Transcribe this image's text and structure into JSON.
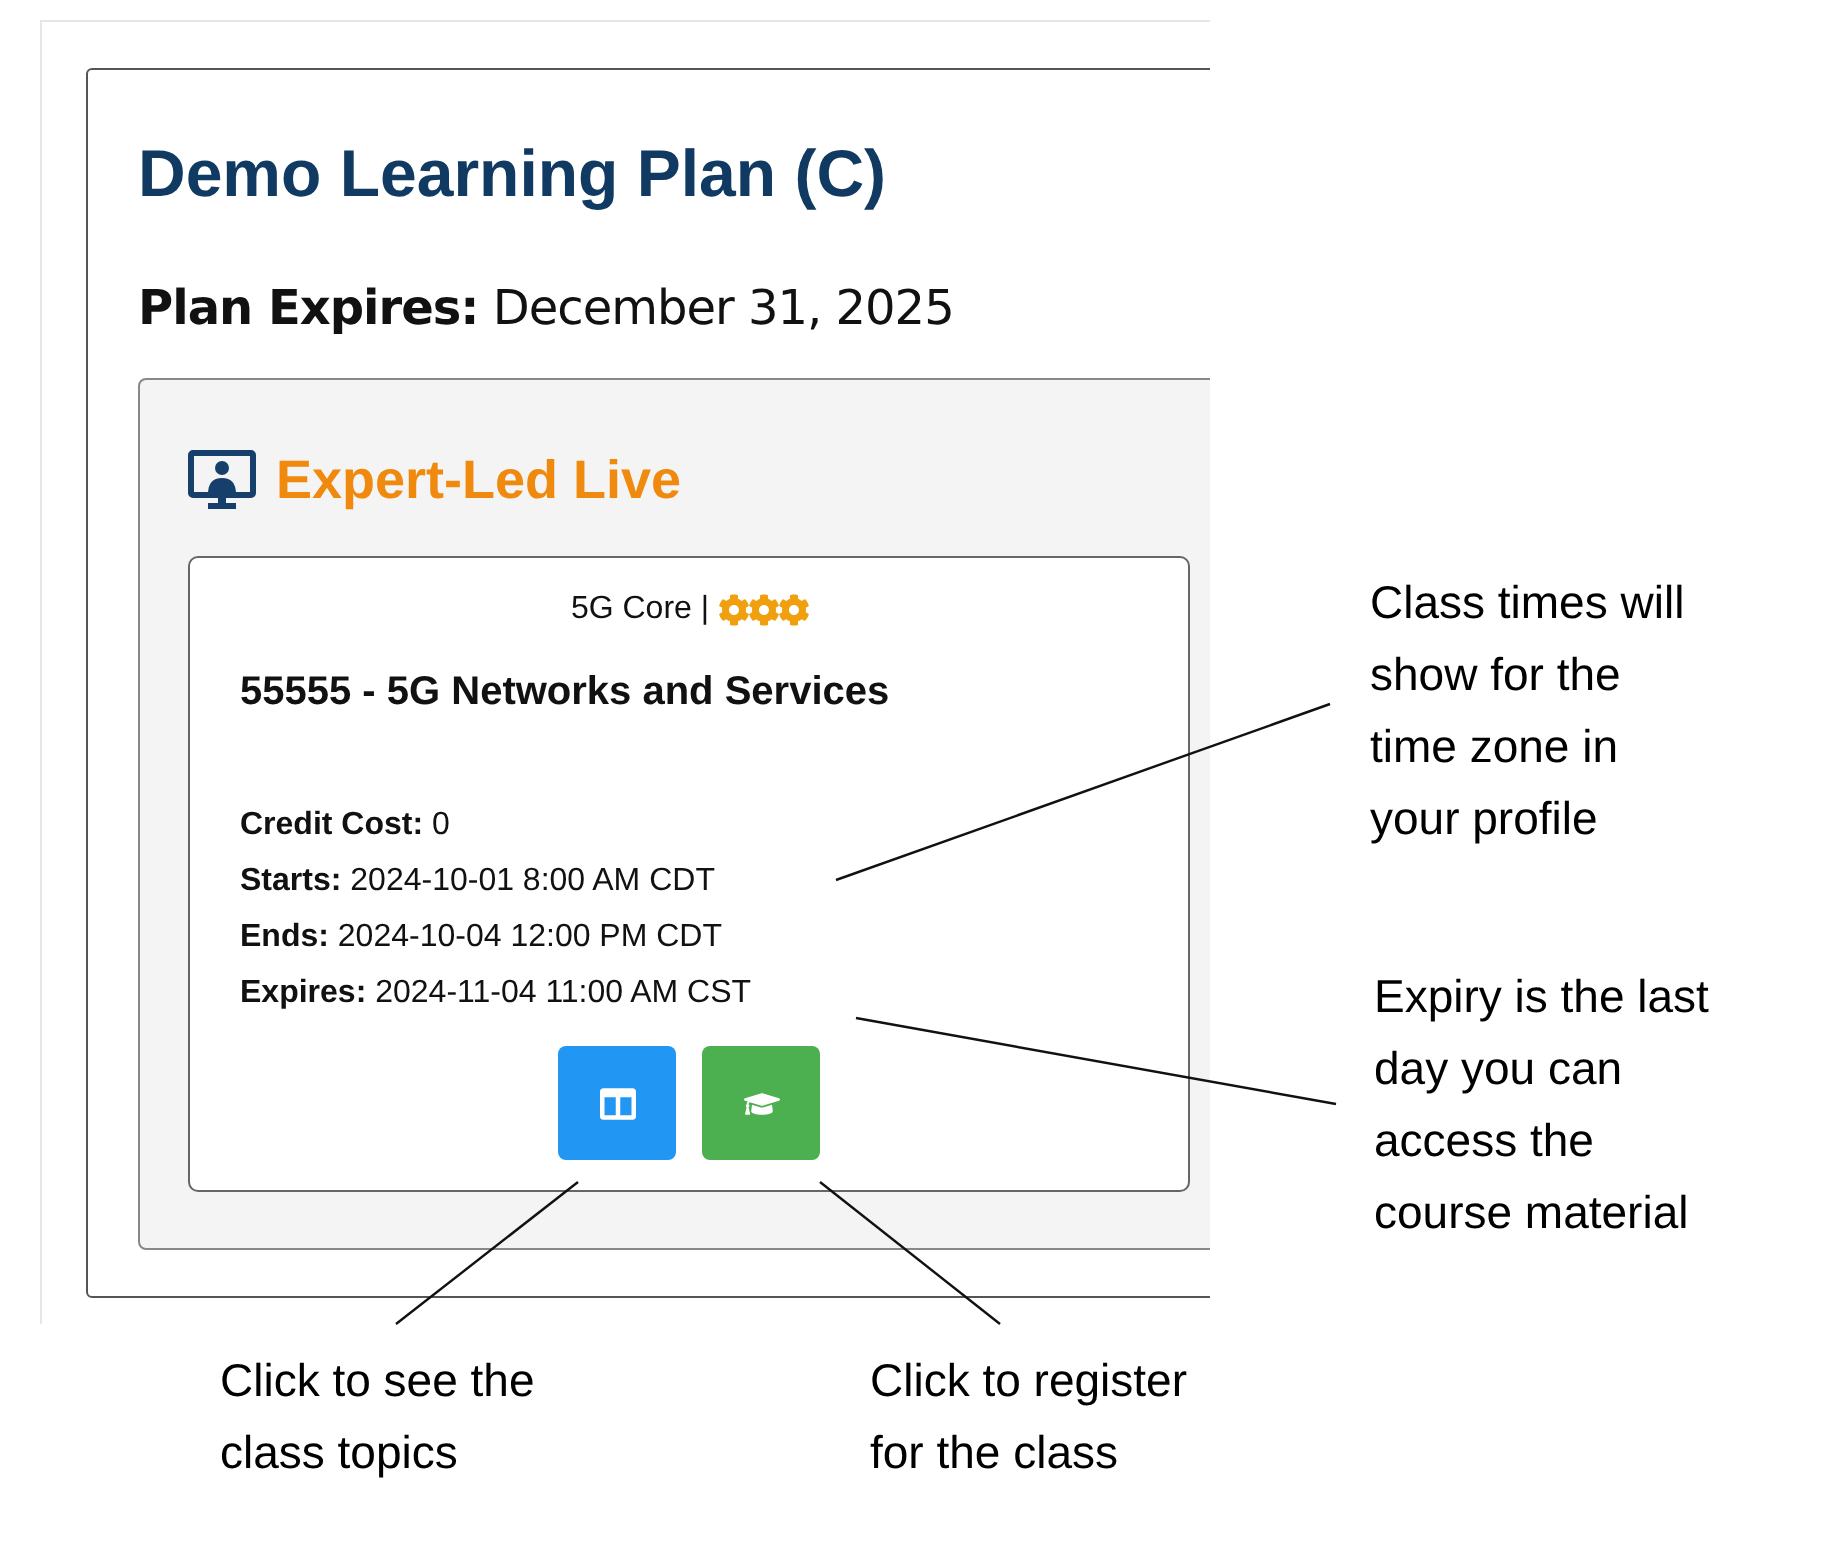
{
  "plan": {
    "title": "Demo Learning Plan (C)",
    "expires_label": "Plan Expires:",
    "expires_value": "December 31, 2025"
  },
  "section": {
    "title": "Expert-Led Live"
  },
  "card": {
    "category": "5G Core |",
    "title": "55555 - 5G Networks and Services",
    "details": [
      {
        "label": "Credit Cost:",
        "value": "0"
      },
      {
        "label": "Starts:",
        "value": "2024-10-01 8:00 AM CDT"
      },
      {
        "label": "Ends:",
        "value": "2024-10-04 12:00 PM CDT"
      },
      {
        "label": "Expires:",
        "value": "2024-11-04 11:00 AM CST"
      }
    ],
    "buttons": [
      {
        "kind": "topics"
      },
      {
        "kind": "register"
      }
    ]
  },
  "annotations": [
    {
      "text": "Class times will show for the time zone in your profile"
    },
    {
      "text": "Expiry is the last day you can access the course material"
    },
    {
      "text": "Click to see the class topics"
    },
    {
      "text": "Click to register for the class"
    }
  ]
}
